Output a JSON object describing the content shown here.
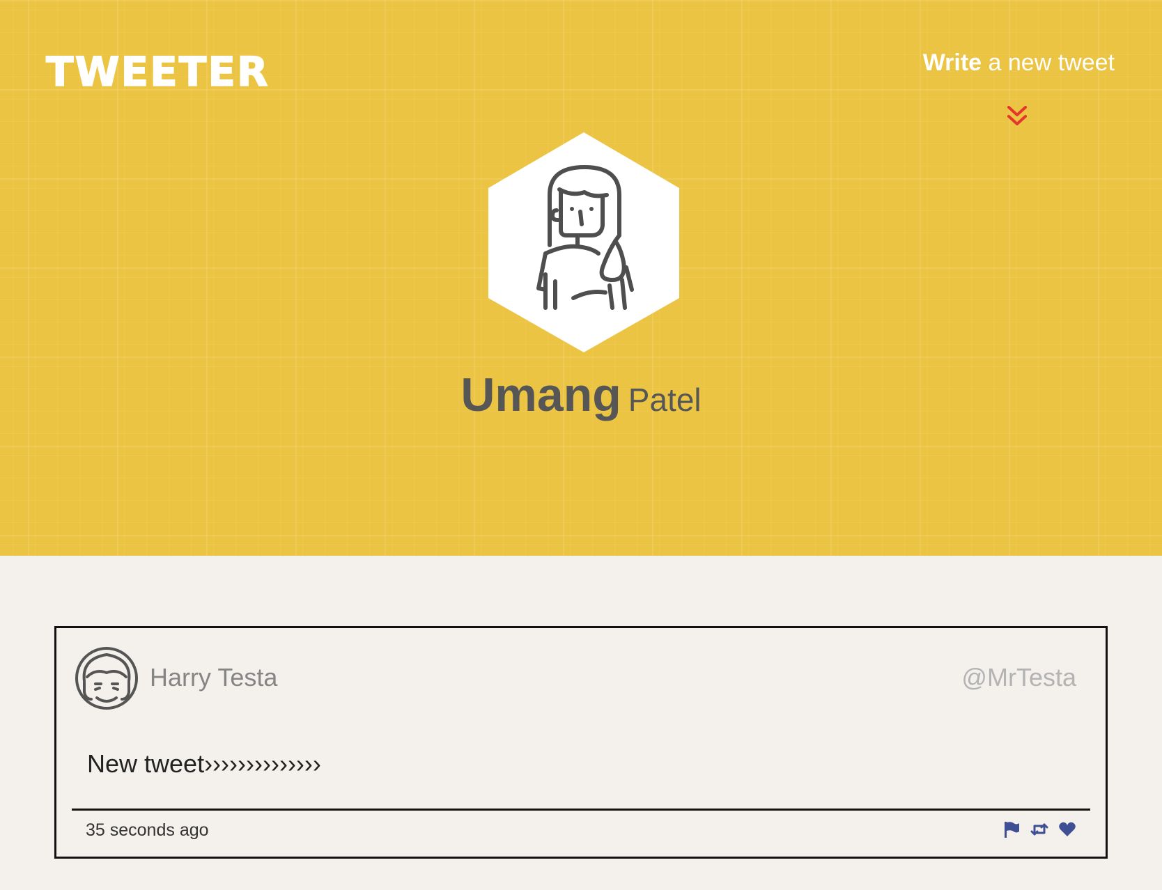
{
  "header": {
    "logo": "TWEETER",
    "compose_strong": "Write",
    "compose_rest": "a new tweet"
  },
  "profile": {
    "first_name": "Umang",
    "last_name": "Patel"
  },
  "tweets": [
    {
      "author": "Harry Testa",
      "handle": "@MrTesta",
      "text": "New tweet››››››››››››››",
      "time": "35 seconds ago",
      "actions": [
        "flag-icon",
        "retweet-icon",
        "heart-icon"
      ]
    }
  ],
  "colors": {
    "hero_bg": "#ecc443",
    "page_bg": "#f4f1ec",
    "accent_red": "#e4362a",
    "action_blue": "#3f4f94",
    "name_gray": "#565656"
  }
}
